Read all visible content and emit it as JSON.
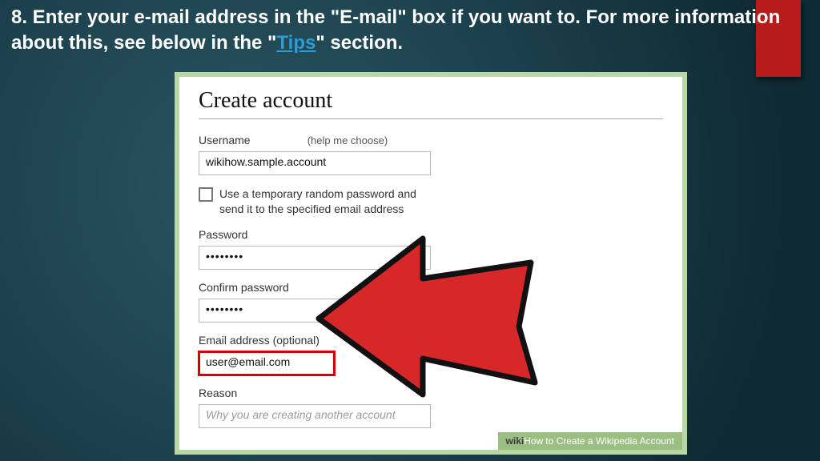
{
  "instruction": {
    "prefix": "8. Enter your e-mail address in the \"E-mail\" box if you want to. For more information about this, see below in the \"",
    "link": "Tips",
    "suffix": "\" section."
  },
  "form": {
    "title": "Create account",
    "username_label": "Username",
    "username_help": "(help me choose)",
    "username_value": "wikihow.sample.account",
    "temp_pw_text": "Use a temporary random password and send it to the specified email address",
    "password_label": "Password",
    "password_value": "••••••••",
    "confirm_label": "Confirm password",
    "confirm_value": "••••••••",
    "email_label": "Email address (optional)",
    "email_value": "user@email.com",
    "reason_label": "Reason",
    "reason_placeholder": "Why you are creating another account"
  },
  "footer": {
    "brand_dark": "wiki",
    "brand_light": "How",
    "tagline": " to Create a Wikipedia Account"
  }
}
